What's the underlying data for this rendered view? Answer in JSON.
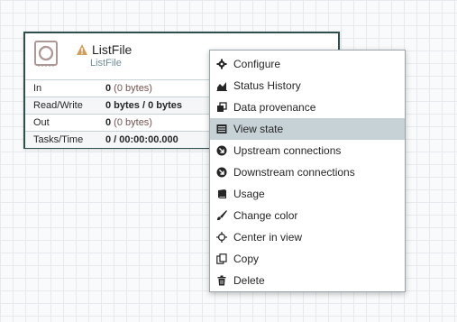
{
  "processor": {
    "name": "ListFile",
    "type": "ListFile",
    "stats": [
      {
        "label": "In",
        "value_bold": "0",
        "value_rest": " (0 bytes)"
      },
      {
        "label": "Read/Write",
        "value_bold": "0 bytes / 0 bytes",
        "value_rest": ""
      },
      {
        "label": "Out",
        "value_bold": "0",
        "value_rest": " (0 bytes)"
      },
      {
        "label": "Tasks/Time",
        "value_bold": "0 / 00:00:00.000",
        "value_rest": ""
      }
    ]
  },
  "context_menu": {
    "items": [
      {
        "label": "Configure",
        "icon": "gear-icon"
      },
      {
        "label": "Status History",
        "icon": "area-chart-icon"
      },
      {
        "label": "Data provenance",
        "icon": "provenance-icon"
      },
      {
        "label": "View state",
        "icon": "state-icon",
        "active": true
      },
      {
        "label": "Upstream connections",
        "icon": "arrow-circle-icon"
      },
      {
        "label": "Downstream connections",
        "icon": "arrow-circle-icon"
      },
      {
        "label": "Usage",
        "icon": "book-icon"
      },
      {
        "label": "Change color",
        "icon": "paint-brush-icon"
      },
      {
        "label": "Center in view",
        "icon": "crosshair-icon"
      },
      {
        "label": "Copy",
        "icon": "copy-icon"
      },
      {
        "label": "Delete",
        "icon": "trash-icon"
      }
    ]
  },
  "colors": {
    "processor_border": "#2f4f4f",
    "menu_active_bg": "#c7d2d7",
    "warning": "#cf9f5d"
  }
}
